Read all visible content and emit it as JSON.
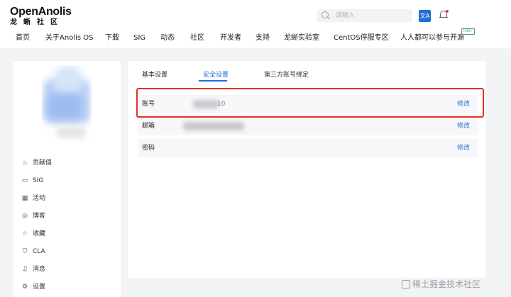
{
  "header": {
    "logo_main": "OpenAnolis",
    "logo_sub": "龙蜥社区",
    "search_placeholder": "请输入",
    "lang_icon_text": "文A",
    "nav": [
      "首页",
      "关于Anolis OS",
      "下载",
      "SIG",
      "动态",
      "社区",
      "开发者",
      "支持",
      "龙蜥实验室",
      "CentOS停服专区",
      "人人都可以参与开源"
    ],
    "hot_badge": "HOT"
  },
  "sidebar": {
    "menu": [
      {
        "label": "贡献值",
        "icon": "medal-icon"
      },
      {
        "label": "SIG",
        "icon": "sig-icon"
      },
      {
        "label": "活动",
        "icon": "calendar-icon"
      },
      {
        "label": "博客",
        "icon": "blog-icon"
      },
      {
        "label": "收藏",
        "icon": "star-icon"
      },
      {
        "label": "CLA",
        "icon": "shield-check-icon"
      },
      {
        "label": "消息",
        "icon": "bell-icon"
      },
      {
        "label": "设置",
        "icon": "gear-icon"
      }
    ]
  },
  "main": {
    "tabs": [
      "基本设置",
      "安全设置",
      "第三方账号绑定"
    ],
    "active_tab": "安全设置",
    "rows": [
      {
        "label": "账号",
        "value": "10",
        "action": "修改"
      },
      {
        "label": "邮箱",
        "value": "",
        "action": "修改"
      },
      {
        "label": "密码",
        "value": "",
        "action": "修改"
      }
    ]
  },
  "watermark": "稀土掘金技术社区",
  "colors": {
    "accent": "#1e6fd8",
    "highlight_border": "#e0322b",
    "hot": "#4aa36c"
  }
}
